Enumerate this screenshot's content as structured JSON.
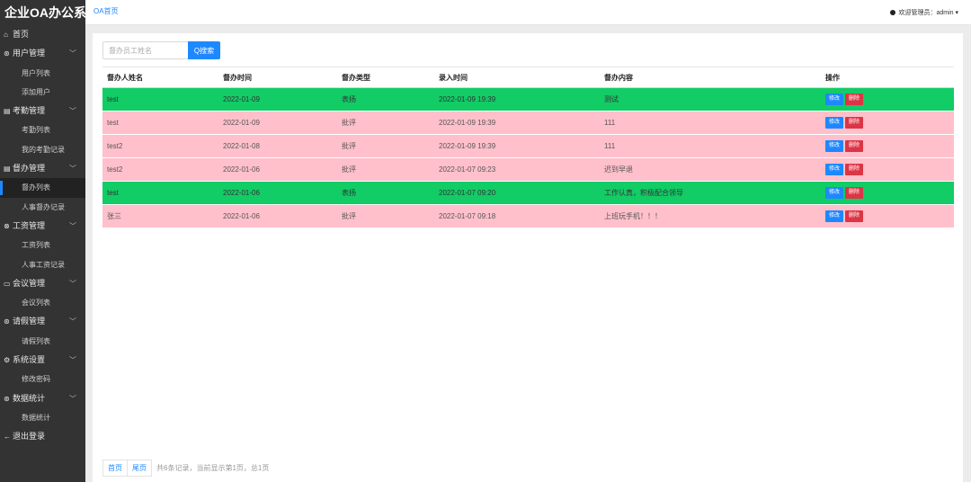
{
  "app": {
    "title": "企业OA办公系统"
  },
  "sidebar": {
    "items": [
      {
        "type": "group",
        "icon": "home-icon",
        "icon_char": "⌂",
        "label": "首页",
        "chevron": false
      },
      {
        "type": "group",
        "icon": "users-icon",
        "icon_char": "⊛",
        "label": "用户管理",
        "chevron": true
      },
      {
        "type": "sub",
        "label": "用户列表"
      },
      {
        "type": "sub",
        "label": "添加用户"
      },
      {
        "type": "group",
        "icon": "attendance-icon",
        "icon_char": "▤",
        "label": "考勤管理",
        "chevron": true
      },
      {
        "type": "sub",
        "label": "考勤列表"
      },
      {
        "type": "sub",
        "label": "我的考勤记录"
      },
      {
        "type": "group",
        "icon": "supervise-icon",
        "icon_char": "▤",
        "label": "督办管理",
        "chevron": true
      },
      {
        "type": "sub",
        "label": "督办列表",
        "active": true
      },
      {
        "type": "sub",
        "label": "人事督办记录"
      },
      {
        "type": "group",
        "icon": "salary-icon",
        "icon_char": "⊗",
        "label": "工资管理",
        "chevron": true
      },
      {
        "type": "sub",
        "label": "工资列表"
      },
      {
        "type": "sub",
        "label": "人事工资记录"
      },
      {
        "type": "group",
        "icon": "meeting-icon",
        "icon_char": "▭",
        "label": "会议管理",
        "chevron": true
      },
      {
        "type": "sub",
        "label": "会议列表"
      },
      {
        "type": "group",
        "icon": "leave-icon",
        "icon_char": "⊛",
        "label": "请假管理",
        "chevron": true
      },
      {
        "type": "sub",
        "label": "请假列表"
      },
      {
        "type": "group",
        "icon": "settings-icon",
        "icon_char": "⚙",
        "label": "系统设置",
        "chevron": true
      },
      {
        "type": "sub",
        "label": "修改密码"
      },
      {
        "type": "group",
        "icon": "stats-icon",
        "icon_char": "⊛",
        "label": "数据统计",
        "chevron": true
      },
      {
        "type": "sub",
        "label": "数据统计"
      },
      {
        "type": "group",
        "icon": "logout-icon",
        "icon_char": "←",
        "label": "退出登录",
        "chevron": false
      }
    ]
  },
  "topbar": {
    "breadcrumb": "OA首页",
    "user_label": "欢迎管理员：admin ▾"
  },
  "search": {
    "placeholder": "督办员工姓名",
    "button_label": "Q搜索"
  },
  "table": {
    "headers": [
      "督办人姓名",
      "督办时间",
      "督办类型",
      "录入时间",
      "督办内容",
      "操作"
    ],
    "edit_label": "修改",
    "delete_label": "删除",
    "rows": [
      {
        "name": "test",
        "date": "2022-01-09",
        "type": "表扬",
        "entered": "2022-01-09 19:39",
        "content": "测试",
        "status": "praise"
      },
      {
        "name": "test",
        "date": "2022-01-09",
        "type": "批评",
        "entered": "2022-01-09 19:39",
        "content": "111",
        "status": "criticism"
      },
      {
        "name": "test2",
        "date": "2022-01-08",
        "type": "批评",
        "entered": "2022-01-09 19:39",
        "content": "111",
        "status": "criticism"
      },
      {
        "name": "test2",
        "date": "2022-01-06",
        "type": "批评",
        "entered": "2022-01-07 09:23",
        "content": "迟到早退",
        "status": "criticism"
      },
      {
        "name": "test",
        "date": "2022-01-06",
        "type": "表扬",
        "entered": "2022-01-07 09:20",
        "content": "工作认真，积极配合领导",
        "status": "praise"
      },
      {
        "name": "张三",
        "date": "2022-01-06",
        "type": "批评",
        "entered": "2022-01-07 09:18",
        "content": "上班玩手机！！！",
        "status": "criticism"
      }
    ]
  },
  "pager": {
    "first_label": "首页",
    "last_label": "尾页",
    "info": "共6条记录，当前显示第1页，总1页"
  },
  "colors": {
    "praise_row": "#12cc66",
    "criticism_row": "#ffc0cb",
    "primary": "#1e88ff",
    "danger": "#dc3545",
    "sidebar_bg": "#333333"
  }
}
